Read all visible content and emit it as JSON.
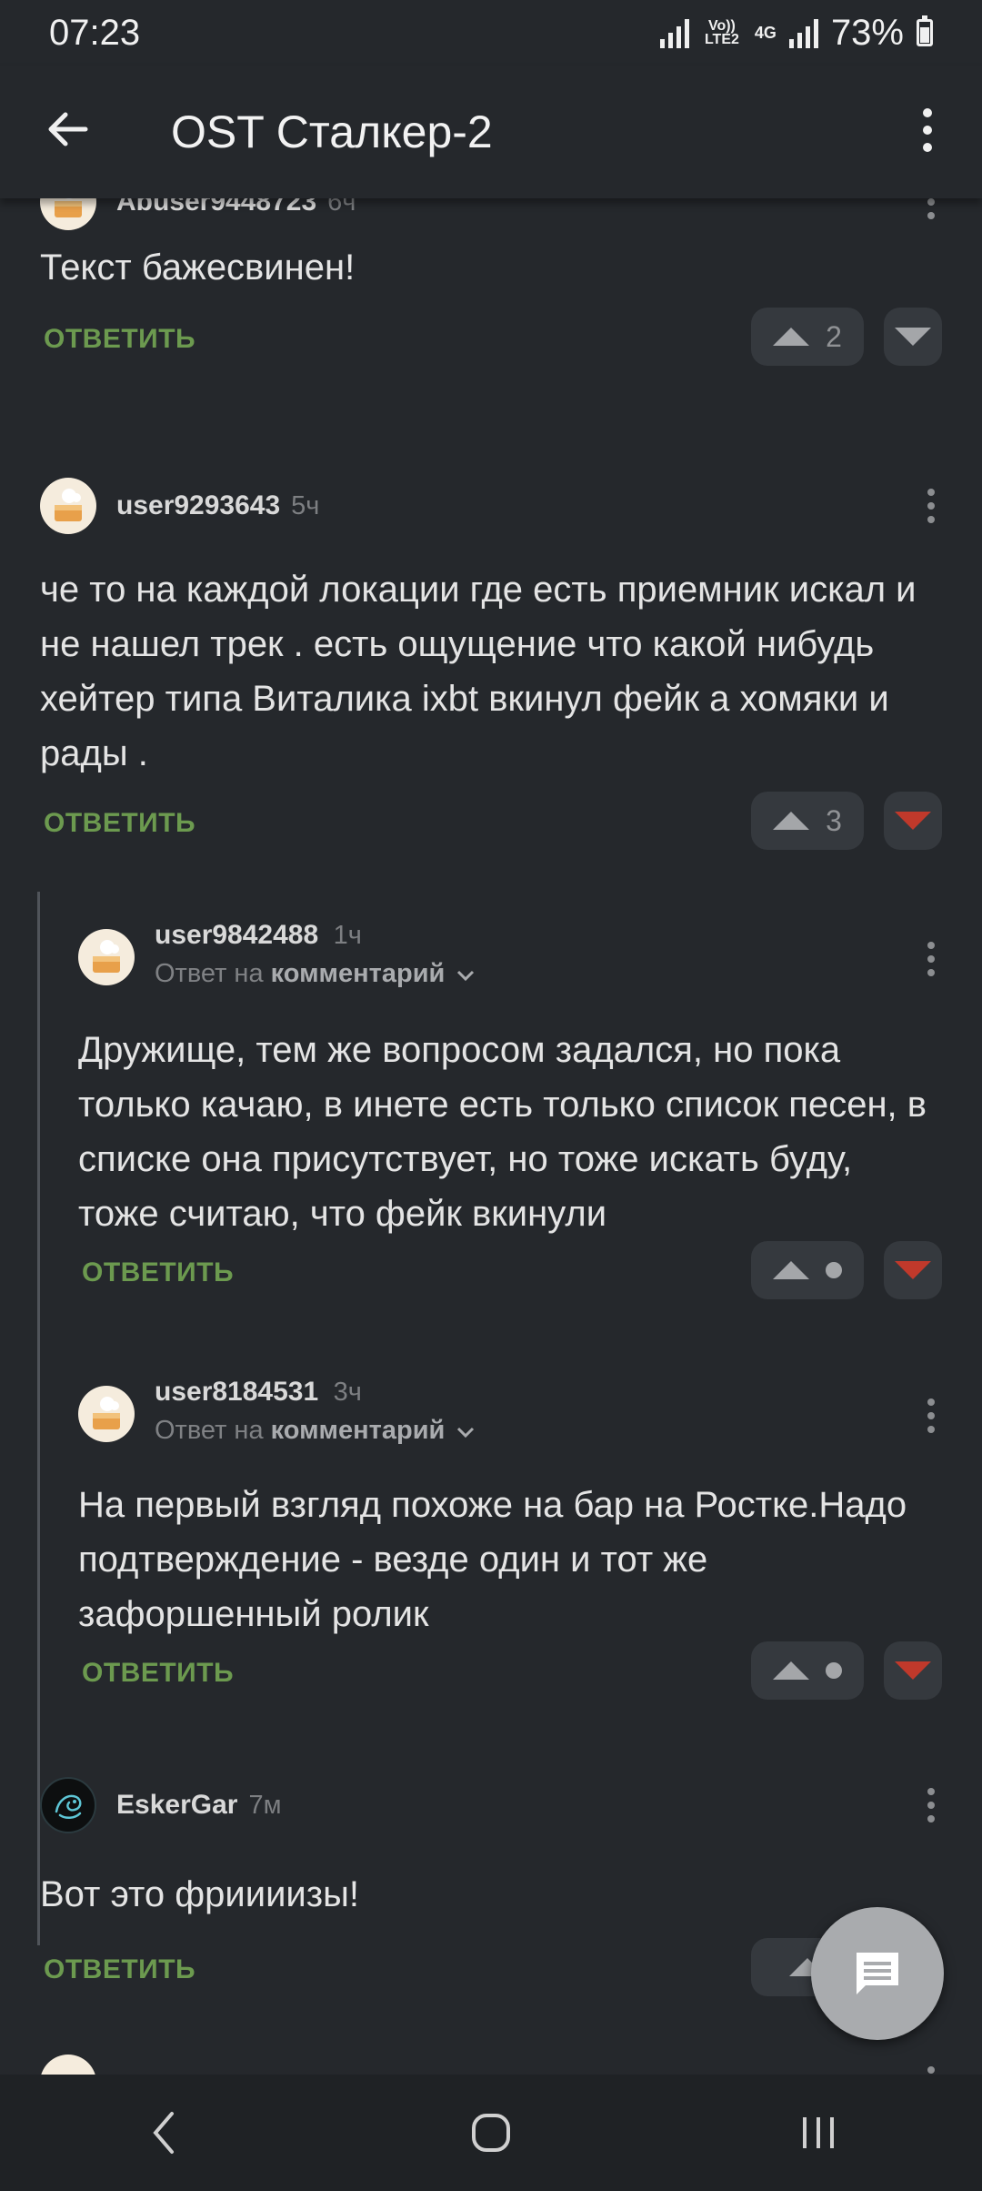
{
  "status": {
    "time": "07:23",
    "network_top": "Vo)) LTE2",
    "network_4g": "4G",
    "battery": "73%"
  },
  "appbar": {
    "title": "OST Сталкер-2"
  },
  "reply_label": "ОТВЕТИТЬ",
  "reply_to_prefix": "Ответ на",
  "reply_to_target": "комментарий",
  "comments": [
    {
      "user": "Abuser9448723",
      "time": "6ч",
      "text": "Текст бажесвинен!",
      "votes": "2",
      "downvoted": false
    },
    {
      "user": "user9293643",
      "time": "5ч",
      "text": "че то на каждой локации где есть приемник искал и не нашел трек . есть ощущение что какой нибудь хейтер типа Виталика ixbt вкинул фейк а хомяки и рады .",
      "votes": "3",
      "downvoted": true
    },
    {
      "user": "user9842488",
      "time": "1ч",
      "text": "Дружище, тем же вопросом задался, но пока только качаю, в инете есть только список песен, в списке она присутствует, но тоже искать буду, тоже считаю, что фейк вкинули",
      "downvoted": true
    },
    {
      "user": "user8184531",
      "time": "3ч",
      "text": "На первый взгляд похоже на бар на Ростке.Надо подтверждение - везде один и тот же зафоршенный ролик",
      "downvoted": true
    },
    {
      "user": "EskerGar",
      "time": "7м",
      "text": "Вот это фриииизы!"
    }
  ],
  "colors": {
    "background": "#25282c",
    "accent_reply": "#6c9a4f",
    "downvote_active": "#c0392b"
  }
}
